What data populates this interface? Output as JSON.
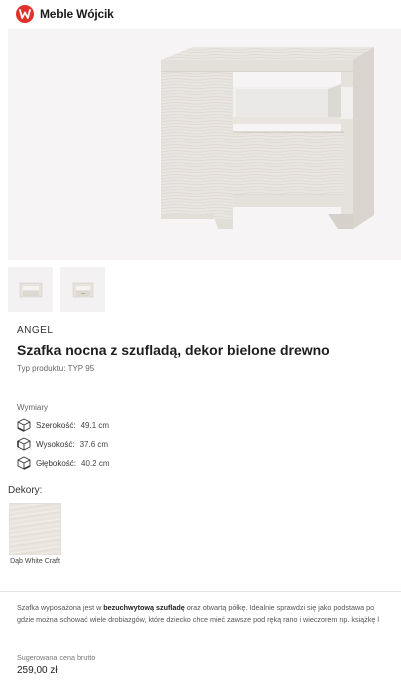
{
  "header": {
    "logo_text": "Meble Wójcik"
  },
  "product": {
    "brand": "ANGEL",
    "title": "Szafka nocna z szufladą, dekor bielone drewno",
    "type_label": "Typ produktu:",
    "type_value": "TYP 95"
  },
  "dimensions": {
    "heading": "Wymiary",
    "items": [
      {
        "label": "Szerokość:",
        "value": "49.1 cm"
      },
      {
        "label": "Wysokość:",
        "value": "37.6 cm"
      },
      {
        "label": "Głębokość:",
        "value": "40.2 cm"
      }
    ]
  },
  "decors": {
    "heading": "Dekory:",
    "items": [
      {
        "label": "Dąb White Craft"
      }
    ]
  },
  "description": {
    "line1_pre": "Szafka wyposażona jest w ",
    "line1_bold": "bezuchwytową szufladę",
    "line1_post": " oraz otwartą półkę. Idealnie sprawdzi się jako podstawa po",
    "line2": "gdzie można schować wiele drobiazgów, które dziecko chce mieć zawsze pod ręką rano i wieczorem np. książkę l"
  },
  "price": {
    "label": "Sugerowana cena brutto",
    "value": "259,00 zł"
  },
  "colors": {
    "brand_red": "#e0312a",
    "wood_light": "#e9e6e1"
  }
}
